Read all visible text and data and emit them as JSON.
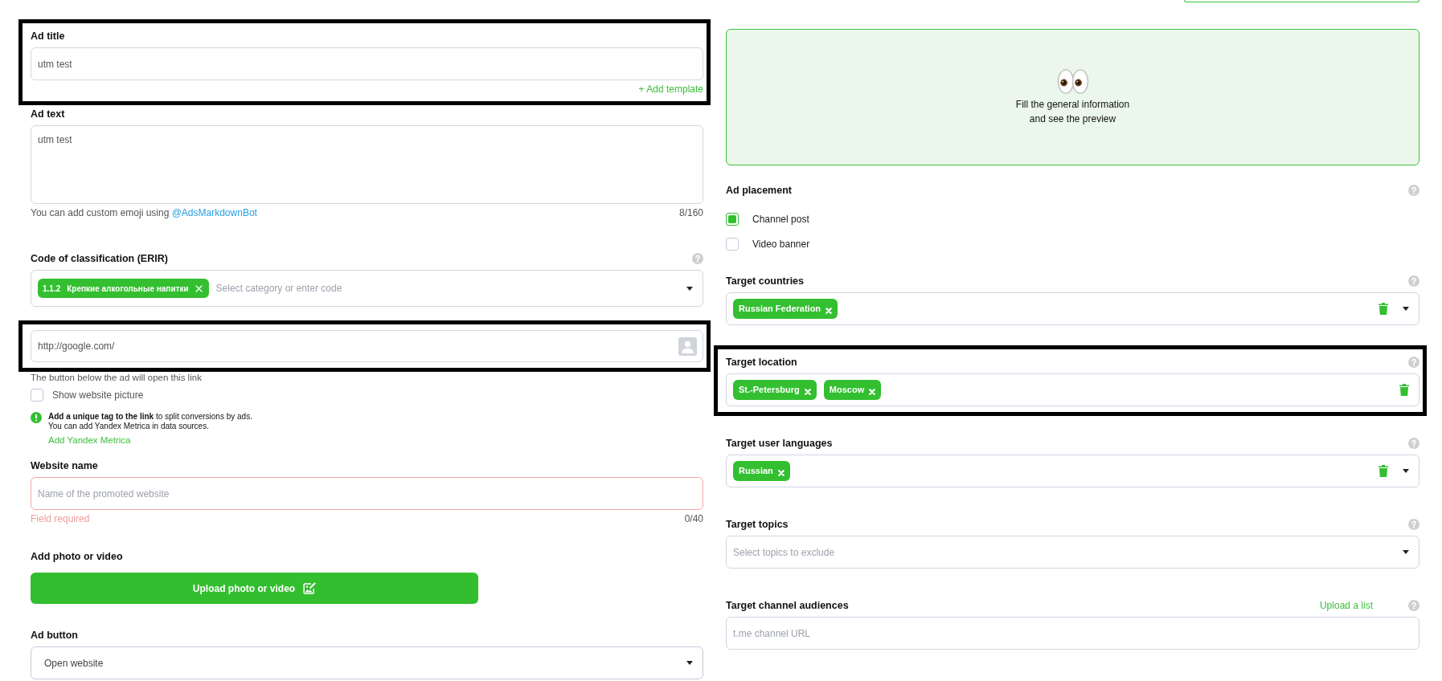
{
  "left_column": {
    "sections": [
      {
        "kind": "input",
        "label": "Ad title",
        "help": false,
        "value": "utm test",
        "action_link": "+ Add template",
        "highlighted": true
      },
      {
        "kind": "textarea",
        "label": "Ad text",
        "help": false,
        "value": "utm test",
        "hint": "You can add custom emoji using",
        "hint_link": "@AdsMarkdownBot",
        "counter": "8/160",
        "highlighted": false
      },
      {
        "kind": "tag_select",
        "label": "Code of classification (ERIR)",
        "help": true,
        "tags": [
          {
            "code": "1.1.2",
            "text": "Крепкие алкогольные напитки"
          }
        ],
        "placeholder": "Select category or enter code",
        "clearable": false,
        "dropdown": true,
        "highlighted": false
      },
      {
        "kind": "url_input",
        "help": false,
        "value": "http://google.com/",
        "highlighted": true,
        "note": "The button below the ad will open this link",
        "checkbox": {
          "label": "Show website picture",
          "checked": false
        },
        "notice": {
          "text": "**Add a unique tag to the link** to split conversions by ads.\nYou can add Yandex Metrica in data sources.",
          "link": "Add Yandex Metrica"
        }
      },
      {
        "kind": "input",
        "label": "Website name",
        "help": false,
        "placeholder": "Name of the promoted website",
        "invalid": true,
        "error": "Field required",
        "counter": "0/40",
        "highlighted": false
      },
      {
        "kind": "upload",
        "label": "Add photo or video",
        "help": false,
        "button": "Upload photo or video",
        "highlighted": false
      },
      {
        "kind": "select",
        "label": "Ad button",
        "help": false,
        "value": "Open website",
        "dropdown": true,
        "highlighted": false
      }
    ]
  },
  "right_column": {
    "sections": [
      {
        "kind": "preview",
        "help": false,
        "message": "Fill the general information\nand see the preview",
        "highlighted": false
      },
      {
        "kind": "checkbox_group",
        "label": "Ad placement",
        "help": true,
        "options": [
          {
            "label": "Channel post",
            "checked": true
          },
          {
            "label": "Video banner",
            "checked": false
          }
        ],
        "highlighted": false
      },
      {
        "kind": "tag_select",
        "label": "Target countries",
        "help": true,
        "tags": [
          {
            "text": "Russian Federation"
          }
        ],
        "clearable": true,
        "dropdown": true,
        "highlighted": false
      },
      {
        "kind": "tag_select",
        "label": "Target location",
        "help": true,
        "tags": [
          {
            "text": "St.-Petersburg"
          },
          {
            "text": "Moscow"
          }
        ],
        "clearable": true,
        "dropdown": false,
        "highlighted": true
      },
      {
        "kind": "tag_select",
        "label": "Target user languages",
        "help": true,
        "tags": [
          {
            "text": "Russian"
          }
        ],
        "clearable": true,
        "dropdown": true,
        "highlighted": false
      },
      {
        "kind": "tag_select",
        "label": "Target topics",
        "help": true,
        "placeholder": "Select topics to exclude",
        "clearable": false,
        "dropdown": true,
        "highlighted": false
      },
      {
        "kind": "input",
        "label": "Target channel audiences",
        "help": true,
        "label_link": "Upload a list",
        "placeholder": "t.me channel URL",
        "highlighted": false
      }
    ]
  }
}
